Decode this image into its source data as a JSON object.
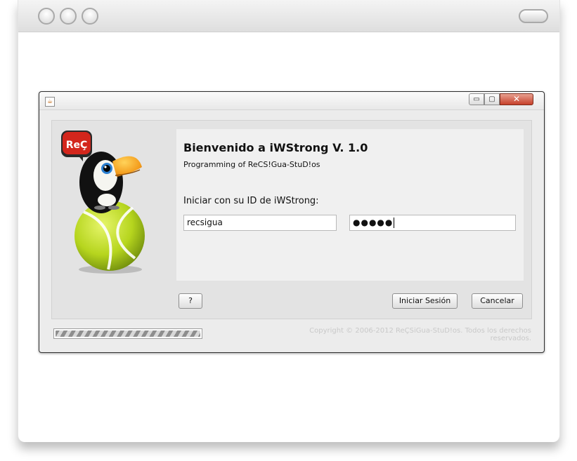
{
  "app": {
    "title_bar_icon": "java-cup-icon",
    "window_controls": {
      "minimize": "▭",
      "maximize": "▢",
      "close": "✕"
    }
  },
  "logo": {
    "badge_text": "ReÇ",
    "mascot": "toucan-on-tennis-ball"
  },
  "welcome": {
    "title": "Bienvenido a iWStrong V. 1.0",
    "subtitle": "Programming of ReCS!Gua-StuD!os",
    "login_label": "Iniciar con su ID de iWStrong:"
  },
  "form": {
    "username_value": "recsigua",
    "password_value": "●●●●●"
  },
  "buttons": {
    "help_label": "?",
    "login_label": "Iniciar Sesión",
    "cancel_label": "Cancelar"
  },
  "footer": {
    "copyright": "Copyright © 2006-2012 ReÇSiGua-StuD!os. Todos los derechos reservados.",
    "progress_fraction": 1.0
  },
  "colors": {
    "badge_red": "#d3261c",
    "ball_green": "#b6d51e",
    "toucan_beak": "#f39b1b"
  }
}
